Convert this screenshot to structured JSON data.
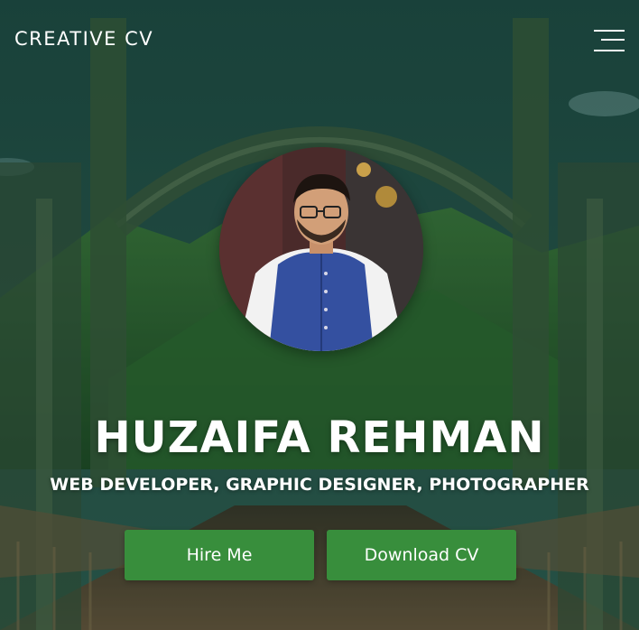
{
  "header": {
    "brand": "CREATIVE CV",
    "menu_icon": "hamburger-menu-icon"
  },
  "profile": {
    "photo_icon": "profile-photo",
    "name": "HUZAIFA REHMAN",
    "roles": "WEB DEVELOPER, GRAPHIC DESIGNER, PHOTOGRAPHER"
  },
  "actions": {
    "hire_label": "Hire Me",
    "download_label": "Download CV"
  },
  "colors": {
    "accent": "#388e3c",
    "text": "#ffffff"
  }
}
